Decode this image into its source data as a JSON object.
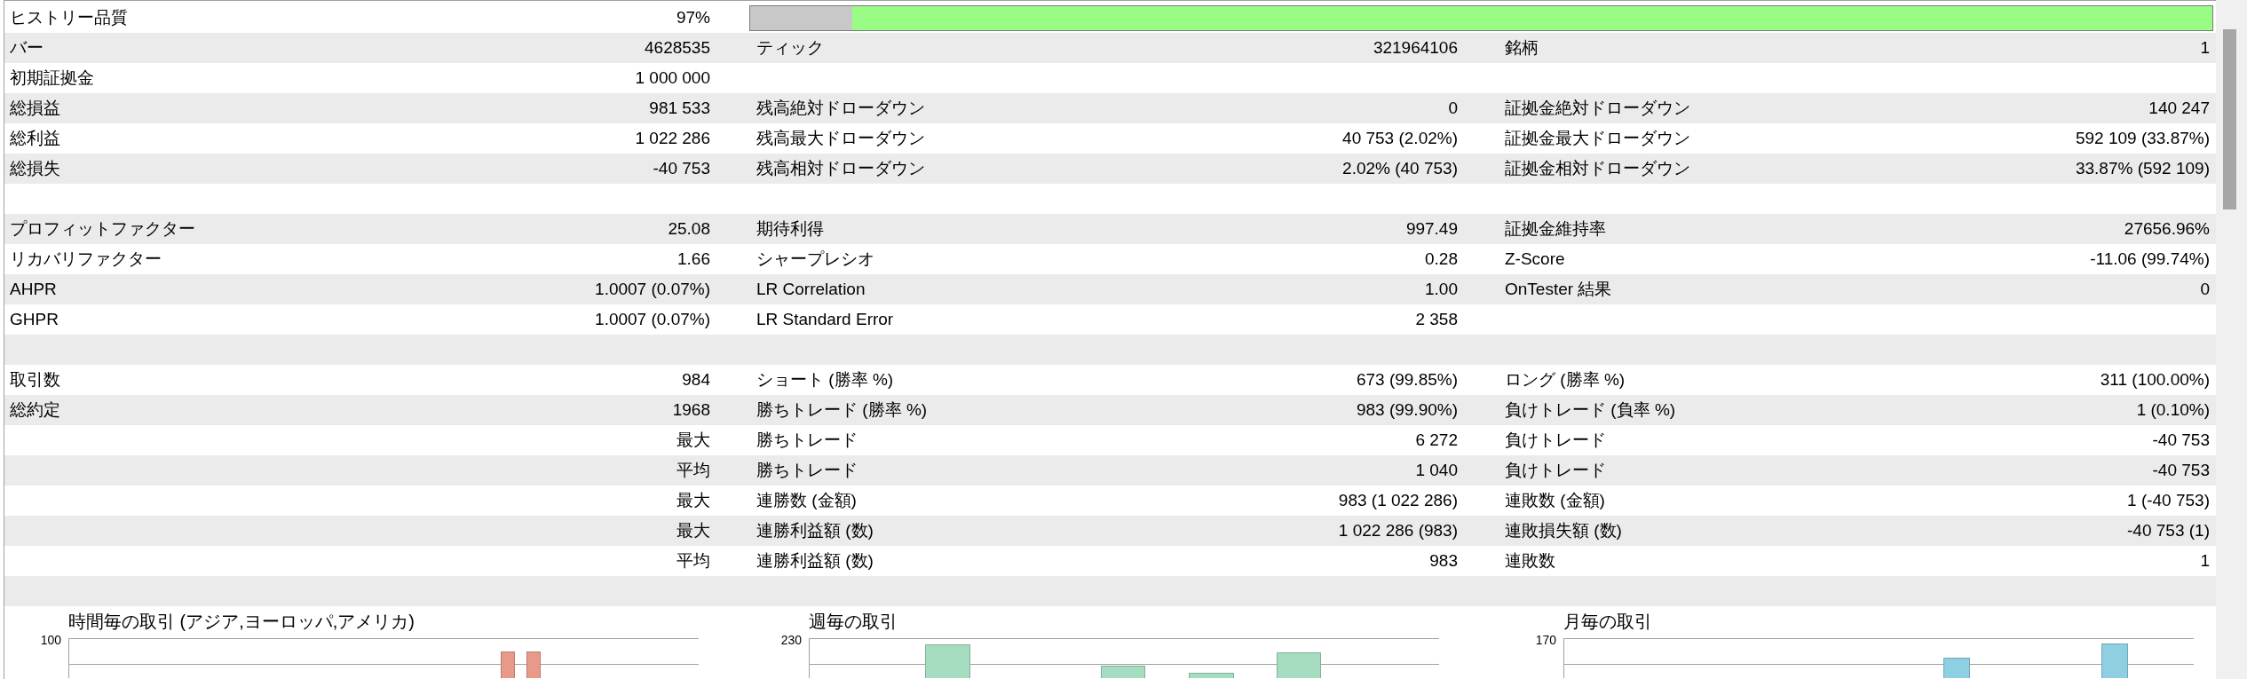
{
  "history_quality": {
    "label": "ヒストリー品質",
    "value": "97%",
    "level": 0.93
  },
  "rows": [
    {
      "kind": "stats",
      "left": {
        "label": "バー",
        "value": "4628535"
      },
      "middle": {
        "label": "ティック",
        "value": "321964106"
      },
      "right": {
        "label": "銘柄",
        "value": "1"
      }
    },
    {
      "kind": "stats",
      "left": {
        "label": "初期証拠金",
        "value": "1 000 000"
      }
    },
    {
      "kind": "stats",
      "left": {
        "label": "総損益",
        "value": "981 533"
      },
      "middle": {
        "label": "残高絶対ドローダウン",
        "value": "0"
      },
      "right": {
        "label": "証拠金絶対ドローダウン",
        "value": "140 247"
      }
    },
    {
      "kind": "stats",
      "left": {
        "label": "総利益",
        "value": "1 022 286"
      },
      "middle": {
        "label": "残高最大ドローダウン",
        "value": "40 753 (2.02%)"
      },
      "right": {
        "label": "証拠金最大ドローダウン",
        "value": "592 109 (33.87%)"
      }
    },
    {
      "kind": "stats",
      "left": {
        "label": "総損失",
        "value": "-40 753"
      },
      "middle": {
        "label": "残高相対ドローダウン",
        "value": "2.02% (40 753)"
      },
      "right": {
        "label": "証拠金相対ドローダウン",
        "value": "33.87% (592 109)"
      }
    },
    {
      "kind": "spacer"
    },
    {
      "kind": "stats",
      "left": {
        "label": "プロフィットファクター",
        "value": "25.08"
      },
      "middle": {
        "label": "期待利得",
        "value": "997.49"
      },
      "right": {
        "label": "証拠金維持率",
        "value": "27656.96%"
      }
    },
    {
      "kind": "stats",
      "left": {
        "label": "リカバリファクター",
        "value": "1.66"
      },
      "middle": {
        "label": "シャープレシオ",
        "value": "0.28"
      },
      "right": {
        "label": "Z-Score",
        "value": "-11.06 (99.74%)"
      }
    },
    {
      "kind": "stats",
      "left": {
        "label": "AHPR",
        "value": "1.0007 (0.07%)"
      },
      "middle": {
        "label": "LR Correlation",
        "value": "1.00"
      },
      "right": {
        "label": "OnTester 結果",
        "value": "0"
      }
    },
    {
      "kind": "stats",
      "left": {
        "label": "GHPR",
        "value": "1.0007 (0.07%)"
      },
      "middle": {
        "label": "LR Standard Error",
        "value": "2 358"
      }
    },
    {
      "kind": "spacer"
    },
    {
      "kind": "stats",
      "left": {
        "label": "取引数",
        "value": "984"
      },
      "middle": {
        "label": "ショート (勝率 %)",
        "value": "673 (99.85%)"
      },
      "right": {
        "label": "ロング (勝率 %)",
        "value": "311 (100.00%)"
      }
    },
    {
      "kind": "stats",
      "left": {
        "label": "総約定",
        "value": "1968"
      },
      "middle": {
        "label": "勝ちトレード (勝率 %)",
        "value": "983 (99.90%)"
      },
      "right": {
        "label": "負けトレード (負率 %)",
        "value": "1 (0.10%)"
      }
    },
    {
      "kind": "stats",
      "left": {
        "value": "最大"
      },
      "middle": {
        "label": "勝ちトレード",
        "value": "6 272"
      },
      "right": {
        "label": "負けトレード",
        "value": "-40 753"
      }
    },
    {
      "kind": "stats",
      "left": {
        "value": "平均"
      },
      "middle": {
        "label": "勝ちトレード",
        "value": "1 040"
      },
      "right": {
        "label": "負けトレード",
        "value": "-40 753"
      }
    },
    {
      "kind": "stats",
      "left": {
        "value": "最大"
      },
      "middle": {
        "label": "連勝数 (金額)",
        "value": "983 (1 022 286)"
      },
      "right": {
        "label": "連敗数 (金額)",
        "value": "1 (-40 753)"
      }
    },
    {
      "kind": "stats",
      "left": {
        "value": "最大"
      },
      "middle": {
        "label": "連勝利益額 (数)",
        "value": "1 022 286 (983)"
      },
      "right": {
        "label": "連敗損失額 (数)",
        "value": "-40 753 (1)"
      }
    },
    {
      "kind": "stats",
      "left": {
        "value": "平均"
      },
      "middle": {
        "label": "連勝利益額 (数)",
        "value": "983"
      },
      "right": {
        "label": "連敗数",
        "value": "1"
      }
    },
    {
      "kind": "spacer"
    }
  ],
  "charts": [
    {
      "title": "時間毎の取引 (アジア,ヨーロッパ,アメリカ)",
      "top_tick": "100",
      "color": "#e89a8a"
    },
    {
      "title": "週毎の取引",
      "top_tick": "230",
      "color": "#a6dcbf"
    },
    {
      "title": "月毎の取引",
      "top_tick": "170",
      "color": "#8ecfe2"
    }
  ]
}
